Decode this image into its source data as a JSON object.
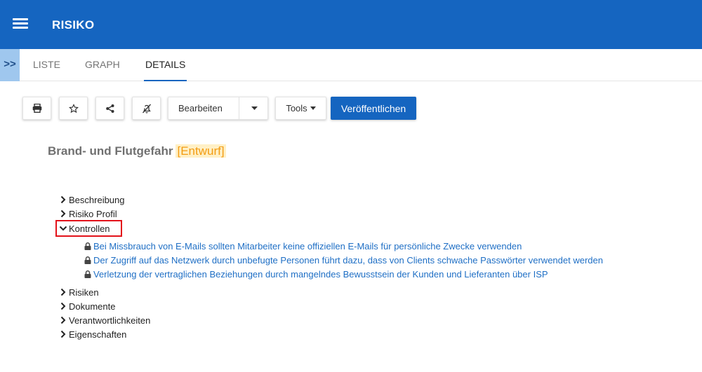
{
  "header": {
    "title": "RISIKO",
    "menu_icon": "hamburger-menu-icon"
  },
  "sidebar_toggle": {
    "label": ">>"
  },
  "tabs": [
    {
      "label": "LISTE",
      "active": false
    },
    {
      "label": "GRAPH",
      "active": false
    },
    {
      "label": "DETAILS",
      "active": true
    }
  ],
  "toolbar": {
    "icons": [
      "print-icon",
      "star-icon",
      "share-icon",
      "bell-off-icon"
    ],
    "edit_label": "Bearbeiten",
    "tools_label": "Tools",
    "publish_label": "Veröffentlichen"
  },
  "record": {
    "title": "Brand- und Flutgefahr",
    "status": "[Entwurf]"
  },
  "tree": {
    "sections": [
      {
        "label": "Beschreibung",
        "expanded": false
      },
      {
        "label": "Risiko Profil",
        "expanded": false
      },
      {
        "label": "Kontrollen",
        "expanded": true,
        "highlighted": true
      },
      {
        "label": "Risiken",
        "expanded": false
      },
      {
        "label": "Dokumente",
        "expanded": false
      },
      {
        "label": "Verantwortlichkeiten",
        "expanded": false
      },
      {
        "label": "Eigenschaften",
        "expanded": false
      }
    ],
    "kontrollen_items": [
      "Bei Missbrauch von E-Mails sollten Mitarbeiter keine offiziellen E-Mails für persönliche Zwecke verwenden",
      "Der Zugriff auf das Netzwerk durch unbefugte Personen führt dazu, dass von Clients schwache Passwörter verwendet werden",
      "Verletzung der vertraglichen Beziehungen durch mangelndes Bewusstsein der Kunden und Lieferanten über ISP"
    ]
  },
  "colors": {
    "header": "#1565c0",
    "link": "#1f6fc5",
    "draft": "#f39c12",
    "highlight_border": "#e3121a"
  }
}
